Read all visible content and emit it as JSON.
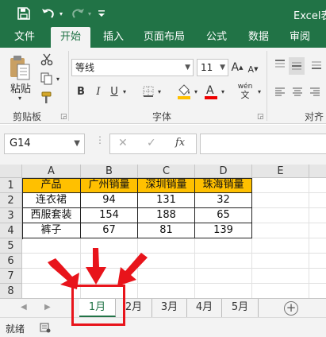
{
  "titlebar": {
    "title": "Excel表",
    "icons": [
      "save-icon",
      "undo-icon",
      "redo-icon",
      "customize-qat-icon"
    ]
  },
  "ribbon_tabs": [
    "文件",
    "开始",
    "插入",
    "页面布局",
    "公式",
    "数据",
    "审阅"
  ],
  "active_tab": "开始",
  "ribbon": {
    "clipboard": {
      "paste_label": "粘贴",
      "group_label": "剪贴板"
    },
    "font": {
      "font_name": "等线",
      "font_size": "11",
      "bold": "B",
      "italic": "I",
      "underline": "U",
      "grow": "A",
      "shrink": "A",
      "phonetic": "wén",
      "group_label": "字体"
    },
    "alignment": {
      "group_label": "对齐"
    }
  },
  "formula_bar": {
    "name_box": "G14",
    "cancel": "✕",
    "enter": "✓",
    "fx": "fx",
    "value": ""
  },
  "columns": [
    "A",
    "B",
    "C",
    "D",
    "E"
  ],
  "rows": [
    "1",
    "2",
    "3",
    "4",
    "5",
    "6",
    "7",
    "8"
  ],
  "table": {
    "headers": [
      "产品",
      "广州销量",
      "深圳销量",
      "珠海销量"
    ],
    "rows": [
      [
        "连衣裙",
        "94",
        "131",
        "32"
      ],
      [
        "西服套装",
        "154",
        "188",
        "65"
      ],
      [
        "裤子",
        "67",
        "81",
        "139"
      ]
    ]
  },
  "sheet_tabs": [
    "1月",
    "2月",
    "3月",
    "4月",
    "5月"
  ],
  "active_sheet": "1月",
  "status": {
    "ready": "就绪"
  },
  "colors": {
    "excel_green": "#217346",
    "header_fill": "#ffc000",
    "annotation_red": "#e8141b"
  }
}
